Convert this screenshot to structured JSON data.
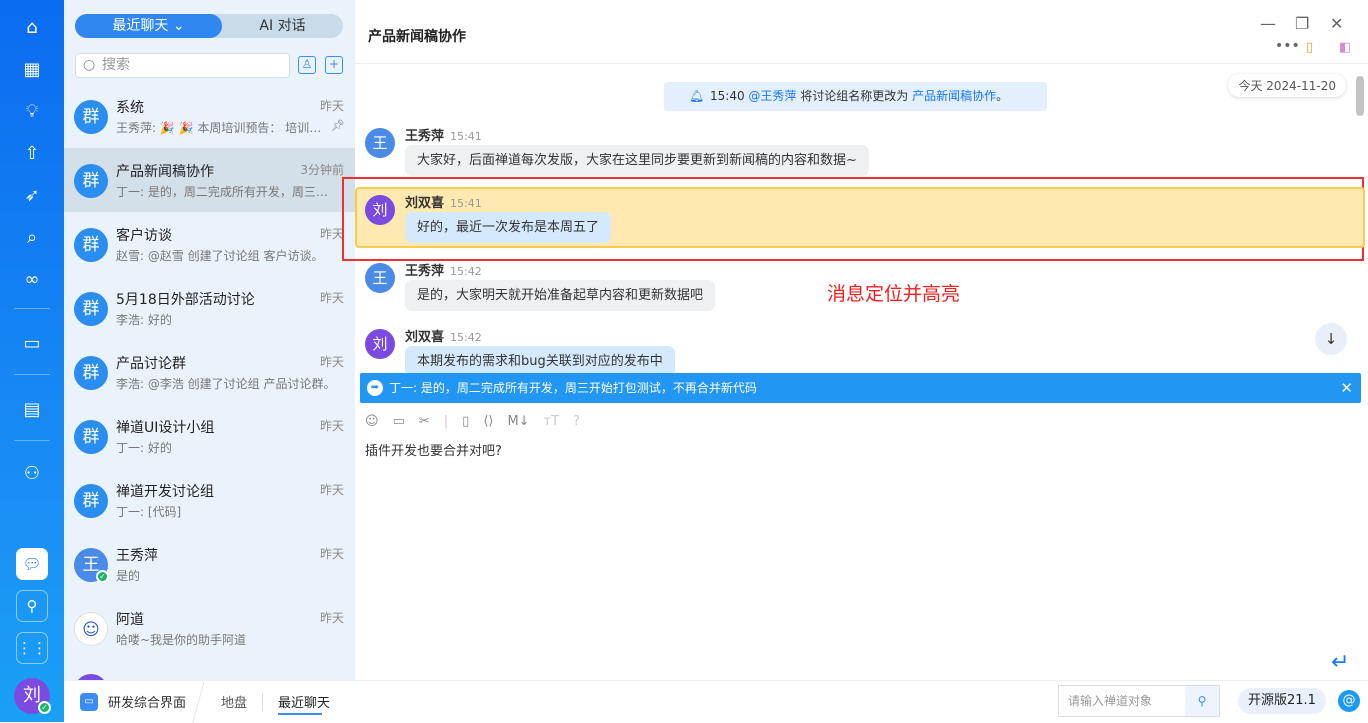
{
  "rail": {
    "icons": [
      "home-icon",
      "apps-icon",
      "bulb-icon",
      "rocket-icon",
      "sprint-icon",
      "search-icon",
      "infinity-icon",
      "board-icon",
      "doc-icon",
      "team-icon"
    ],
    "me_avatar": "刘"
  },
  "list": {
    "tab_recent": "最近聊天",
    "tab_ai": "AI 对话",
    "search_placeholder": "搜索",
    "items": [
      {
        "name": "系统",
        "time": "昨天",
        "preview": "王秀萍: 🎉 🎉 本周培训预告： 培训主...",
        "avatar": "群"
      },
      {
        "name": "产品新闻稿协作",
        "time": "3分钟前",
        "preview": "丁一: 是的，周二完成所有开发，周三开始打包测试，不再合并新代码",
        "avatar": "群"
      },
      {
        "name": "客户访谈",
        "time": "昨天",
        "preview": "赵雪: @赵雪 创建了讨论组 客户访谈。",
        "avatar": "群"
      },
      {
        "name": "5月18日外部活动讨论",
        "time": "昨天",
        "preview": "李浩: 好的",
        "avatar": "群"
      },
      {
        "name": "产品讨论群",
        "time": "昨天",
        "preview": "李浩: @李浩 创建了讨论组 产品讨论群。",
        "avatar": "群"
      },
      {
        "name": "禅道UI设计小组",
        "time": "昨天",
        "preview": "丁一: 好的",
        "avatar": "群"
      },
      {
        "name": "禅道开发讨论组",
        "time": "昨天",
        "preview": "丁一: [代码]",
        "avatar": "群"
      },
      {
        "name": "王秀萍",
        "time": "昨天",
        "preview": "是的",
        "avatar": "王"
      },
      {
        "name": "阿道",
        "time": "昨天",
        "preview": "哈喽~我是你的助手阿道",
        "avatar": "☺"
      }
    ]
  },
  "chat": {
    "title": "产品新闻稿协作",
    "date": "今天 2024-11-20",
    "notice": {
      "time": "15:40",
      "user": "@王秀萍",
      "text": " 将讨论组名称更改为 ",
      "name": "产品新闻稿协作",
      "end": "。"
    },
    "messages": [
      {
        "avatar": "王",
        "sender": "王秀萍",
        "time": "15:41",
        "text": "大家好，后面禅道每次发版，大家在这里同步要更新到新闻稿的内容和数据~"
      },
      {
        "avatar": "刘",
        "sender": "刘双喜",
        "time": "15:41",
        "text": "好的，最近一次发布是本周五了"
      },
      {
        "avatar": "王",
        "sender": "王秀萍",
        "time": "15:42",
        "text": "是的，大家明天就开始准备起草内容和更新数据吧"
      },
      {
        "avatar": "刘",
        "sender": "刘双喜",
        "time": "15:42",
        "text": "本期发布的需求和bug关联到对应的发布中"
      }
    ],
    "annotation": "消息定位并高亮",
    "quote": "丁一: 是的，周二完成所有开发，周三开始打包测试，不再合并新代码",
    "input_text": "插件开发也要合并对吧?"
  },
  "bottom": {
    "app": "研发综合界面",
    "crumb1": "地盘",
    "crumb2": "最近聊天",
    "search_placeholder": "请输入禅道对象",
    "version": "开源版21.1"
  },
  "colors": {
    "accent": "#1677ff",
    "highlight": "#feeab0",
    "annotation": "#f02020"
  }
}
